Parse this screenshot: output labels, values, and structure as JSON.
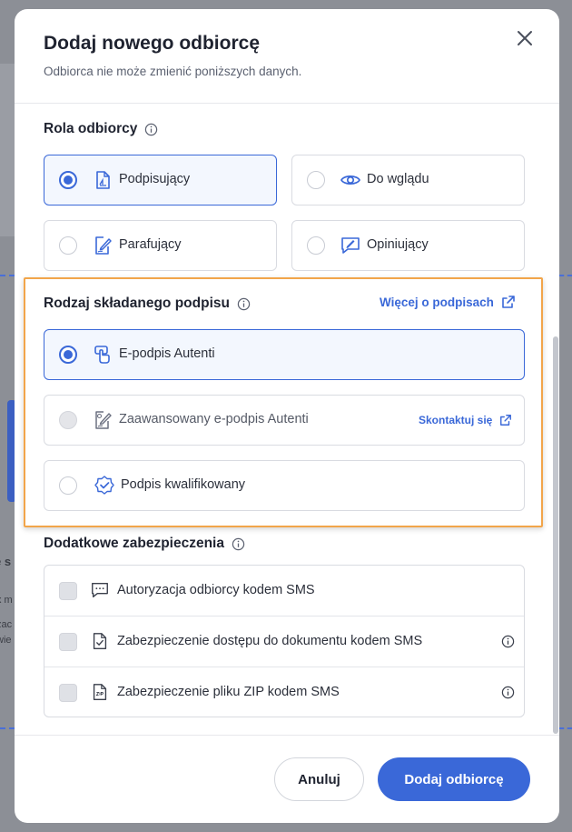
{
  "backdrop": {
    "fragments": [
      "e s",
      "x m",
      "zac",
      "wie"
    ]
  },
  "modal": {
    "title": "Dodaj nowego odbiorcę",
    "subtitle": "Odbiorca nie może zmienić poniższych danych."
  },
  "role_section": {
    "title": "Rola odbiorcy",
    "options": [
      {
        "label": "Podpisujący",
        "icon": "document-sign-icon",
        "selected": true
      },
      {
        "label": "Do wglądu",
        "icon": "eye-icon",
        "selected": false
      },
      {
        "label": "Parafujący",
        "icon": "document-pen-icon",
        "selected": false
      },
      {
        "label": "Opiniujący",
        "icon": "comment-pen-icon",
        "selected": false
      }
    ]
  },
  "signature_section": {
    "title": "Rodzaj składanego podpisu",
    "more_link": "Więcej o podpisach",
    "options": [
      {
        "label": "E-podpis Autenti",
        "icon": "touch-sign-icon",
        "selected": true
      },
      {
        "label": "Zaawansowany e-podpis Autenti",
        "icon": "advanced-sign-icon",
        "selected": false,
        "disabled": true,
        "link": "Skontaktuj się"
      },
      {
        "label": "Podpis kwalifikowany",
        "icon": "certificate-badge-icon",
        "selected": false
      }
    ]
  },
  "security_section": {
    "title": "Dodatkowe zabezpieczenia",
    "items": [
      {
        "label": "Autoryzacja odbiorcy kodem SMS",
        "icon": "sms-bubble-icon",
        "info": false
      },
      {
        "label": "Zabezpieczenie dostępu do dokumentu kodem SMS",
        "icon": "document-check-icon",
        "info": true
      },
      {
        "label": "Zabezpieczenie pliku ZIP kodem SMS",
        "icon": "zip-file-icon",
        "info": true
      }
    ]
  },
  "footer": {
    "cancel_label": "Anuluj",
    "submit_label": "Dodaj odbiorcę"
  },
  "colors": {
    "accent": "#3a68d8",
    "highlight": "#f2a54a"
  }
}
